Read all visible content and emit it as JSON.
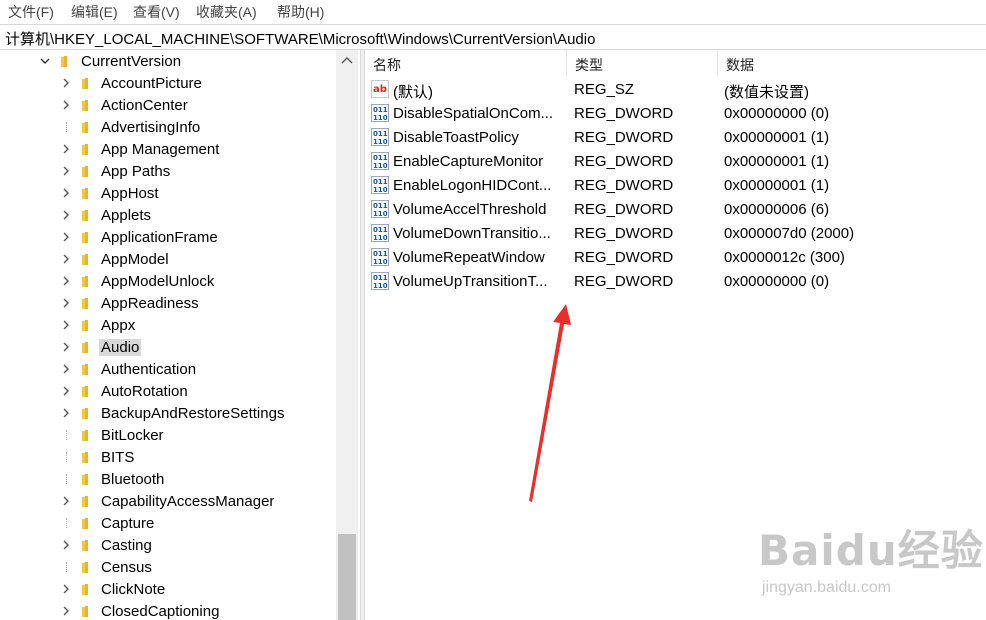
{
  "menu": [
    "文件(F)",
    "编辑(E)",
    "查看(V)",
    "收藏夹(A)",
    "帮助(H)"
  ],
  "address": "计算机\\HKEY_LOCAL_MACHINE\\SOFTWARE\\Microsoft\\Windows\\CurrentVersion\\Audio",
  "tree": {
    "parent": "CurrentVersion",
    "items": [
      {
        "label": "AccountPicture",
        "expandable": true
      },
      {
        "label": "ActionCenter",
        "expandable": true
      },
      {
        "label": "AdvertisingInfo",
        "expandable": false
      },
      {
        "label": "App Management",
        "expandable": true
      },
      {
        "label": "App Paths",
        "expandable": true
      },
      {
        "label": "AppHost",
        "expandable": true
      },
      {
        "label": "Applets",
        "expandable": true
      },
      {
        "label": "ApplicationFrame",
        "expandable": true
      },
      {
        "label": "AppModel",
        "expandable": true
      },
      {
        "label": "AppModelUnlock",
        "expandable": true
      },
      {
        "label": "AppReadiness",
        "expandable": true
      },
      {
        "label": "Appx",
        "expandable": true
      },
      {
        "label": "Audio",
        "expandable": true,
        "selected": true
      },
      {
        "label": "Authentication",
        "expandable": true
      },
      {
        "label": "AutoRotation",
        "expandable": true
      },
      {
        "label": "BackupAndRestoreSettings",
        "expandable": true
      },
      {
        "label": "BitLocker",
        "expandable": false
      },
      {
        "label": "BITS",
        "expandable": false
      },
      {
        "label": "Bluetooth",
        "expandable": false
      },
      {
        "label": "CapabilityAccessManager",
        "expandable": true
      },
      {
        "label": "Capture",
        "expandable": false
      },
      {
        "label": "Casting",
        "expandable": true
      },
      {
        "label": "Census",
        "expandable": false
      },
      {
        "label": "ClickNote",
        "expandable": true
      },
      {
        "label": "ClosedCaptioning",
        "expandable": true
      }
    ]
  },
  "columns": {
    "name": "名称",
    "type": "类型",
    "data": "数据"
  },
  "values": [
    {
      "icon": "string-value-icon",
      "name": "(默认)",
      "type": "REG_SZ",
      "data": "(数值未设置)"
    },
    {
      "icon": "binary-value-icon",
      "name": "DisableSpatialOnCom...",
      "type": "REG_DWORD",
      "data": "0x00000000 (0)"
    },
    {
      "icon": "binary-value-icon",
      "name": "DisableToastPolicy",
      "type": "REG_DWORD",
      "data": "0x00000001 (1)"
    },
    {
      "icon": "binary-value-icon",
      "name": "EnableCaptureMonitor",
      "type": "REG_DWORD",
      "data": "0x00000001 (1)"
    },
    {
      "icon": "binary-value-icon",
      "name": "EnableLogonHIDCont...",
      "type": "REG_DWORD",
      "data": "0x00000001 (1)"
    },
    {
      "icon": "binary-value-icon",
      "name": "VolumeAccelThreshold",
      "type": "REG_DWORD",
      "data": "0x00000006 (6)"
    },
    {
      "icon": "binary-value-icon",
      "name": "VolumeDownTransitio...",
      "type": "REG_DWORD",
      "data": "0x000007d0 (2000)"
    },
    {
      "icon": "binary-value-icon",
      "name": "VolumeRepeatWindow",
      "type": "REG_DWORD",
      "data": "0x0000012c (300)"
    },
    {
      "icon": "binary-value-icon",
      "name": "VolumeUpTransitionT...",
      "type": "REG_DWORD",
      "data": "0x00000000 (0)"
    }
  ],
  "watermark": {
    "logo": "Baidu经验",
    "url": "jingyan.baidu.com"
  },
  "colors": {
    "arrow": "#e8302a",
    "folder": "#f5c842",
    "selected": "#d9d9d9"
  }
}
